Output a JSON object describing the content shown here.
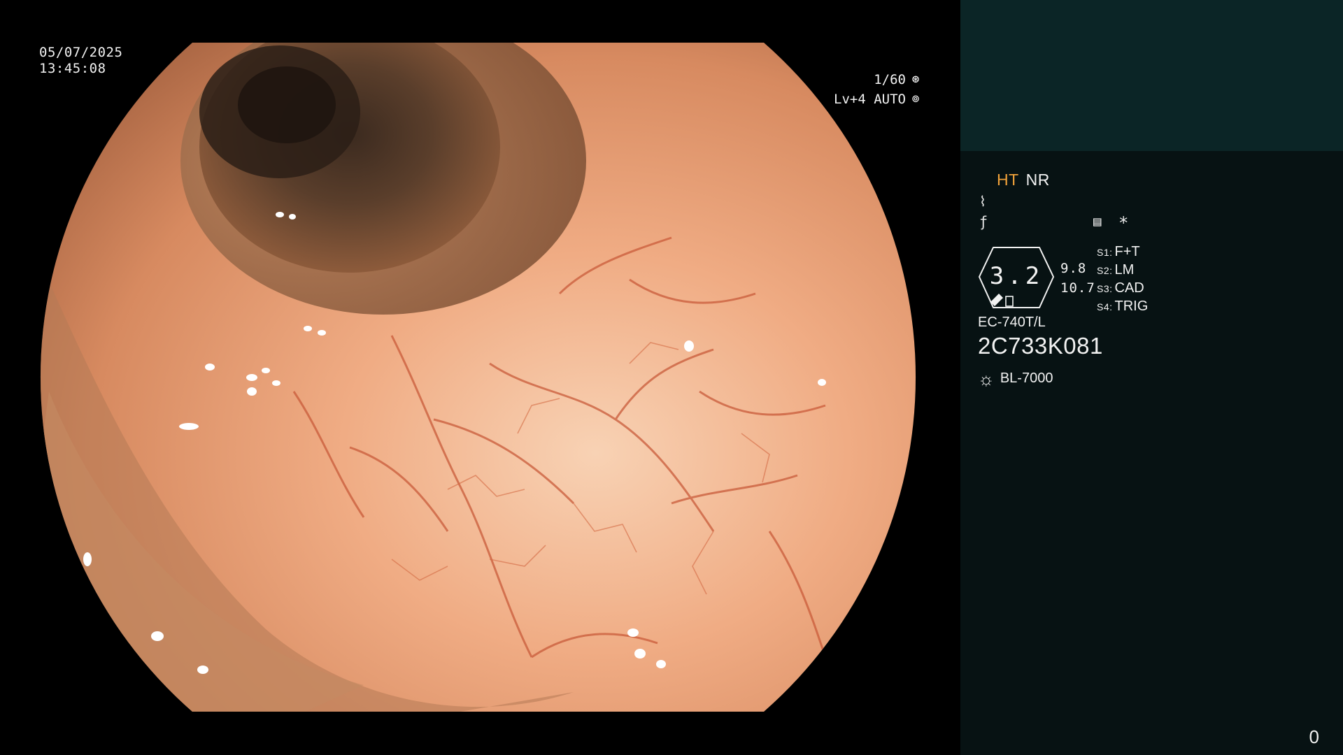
{
  "overlay": {
    "date": "05/07/2025",
    "time": "13:45:08",
    "shutter": "1/60",
    "shutter_icon": "shutter-icon",
    "level": "Lv+4 AUTO",
    "auto_icon": "auto-exposure-icon"
  },
  "panel": {
    "mode_ht": "HT",
    "mode_nr": "NR",
    "icon_row1": "enhancement-curve-icon",
    "icon_row2": "function-icon",
    "memo_icon": "memo-icon",
    "asterisk": "*",
    "badge_value": "3.2",
    "sub_value_1": "9.8",
    "sub_value_2": "10.7",
    "settings": [
      {
        "key": "S1:",
        "value": "F+T"
      },
      {
        "key": "S2:",
        "value": "LM"
      },
      {
        "key": "S3:",
        "value": "CAD"
      },
      {
        "key": "S4:",
        "value": "TRIG"
      }
    ],
    "scope_model": "EC-740T/L",
    "serial": "2C733K081",
    "light_source": "BL-7000",
    "counter": "0"
  },
  "colors": {
    "accent_ht": "#f1a23a",
    "panel_bg": "#071213",
    "panel_top_bg": "#0b2526",
    "tissue": "#e8a27d"
  }
}
